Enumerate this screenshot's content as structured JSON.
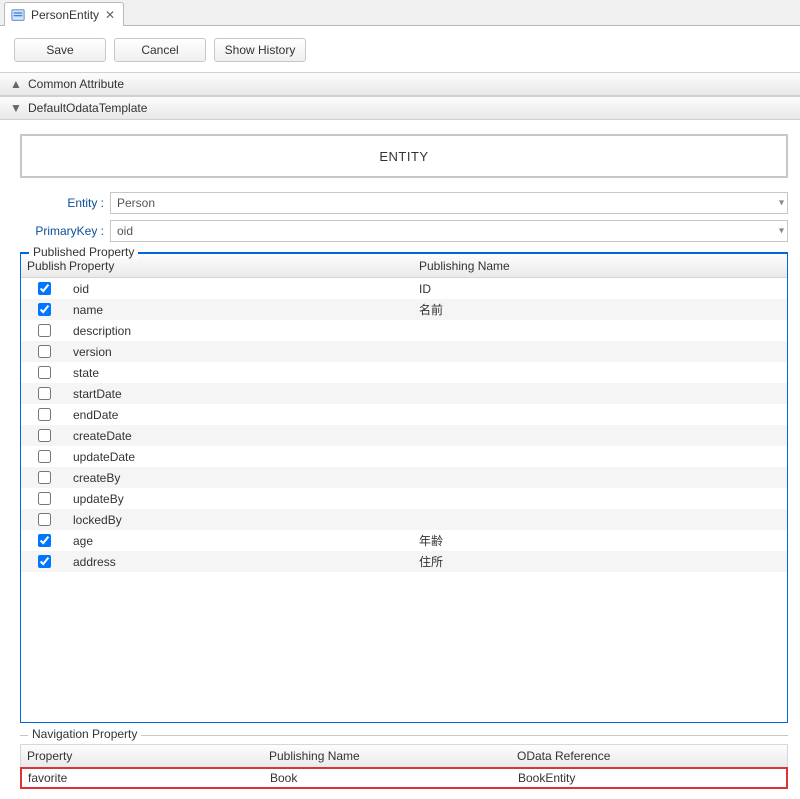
{
  "tab": {
    "label": "PersonEntity"
  },
  "toolbar": {
    "save": "Save",
    "cancel": "Cancel",
    "show_history": "Show History"
  },
  "sections": {
    "common_attribute": "Common Attribute",
    "default_odata_template": "DefaultOdataTemplate"
  },
  "entity_box": "ENTITY",
  "form": {
    "entity_label": "Entity :",
    "entity_value": "Person",
    "primarykey_label": "PrimaryKey :",
    "primarykey_value": "oid"
  },
  "published": {
    "legend": "Published Property",
    "cols": {
      "publish": "Publish",
      "property": "Property",
      "publishing_name": "Publishing Name"
    },
    "rows": [
      {
        "checked": true,
        "property": "oid",
        "publishing_name": "ID"
      },
      {
        "checked": true,
        "property": "name",
        "publishing_name": "名前"
      },
      {
        "checked": false,
        "property": "description",
        "publishing_name": ""
      },
      {
        "checked": false,
        "property": "version",
        "publishing_name": ""
      },
      {
        "checked": false,
        "property": "state",
        "publishing_name": ""
      },
      {
        "checked": false,
        "property": "startDate",
        "publishing_name": ""
      },
      {
        "checked": false,
        "property": "endDate",
        "publishing_name": ""
      },
      {
        "checked": false,
        "property": "createDate",
        "publishing_name": ""
      },
      {
        "checked": false,
        "property": "updateDate",
        "publishing_name": ""
      },
      {
        "checked": false,
        "property": "createBy",
        "publishing_name": ""
      },
      {
        "checked": false,
        "property": "updateBy",
        "publishing_name": ""
      },
      {
        "checked": false,
        "property": "lockedBy",
        "publishing_name": ""
      },
      {
        "checked": true,
        "property": "age",
        "publishing_name": "年齢"
      },
      {
        "checked": true,
        "property": "address",
        "publishing_name": "住所"
      }
    ]
  },
  "navigation": {
    "legend": "Navigation Property",
    "cols": {
      "property": "Property",
      "publishing_name": "Publishing Name",
      "odata_reference": "OData Reference"
    },
    "rows": [
      {
        "property": "favorite",
        "publishing_name": "Book",
        "odata_reference": "BookEntity"
      }
    ]
  }
}
